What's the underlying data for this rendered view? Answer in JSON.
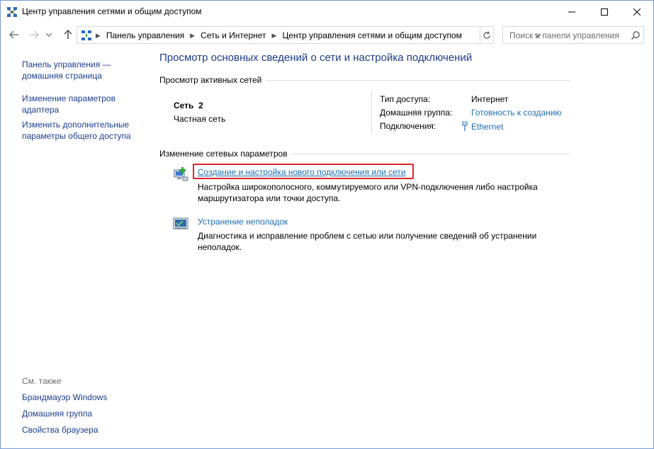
{
  "window": {
    "title": "Центр управления сетями и общим доступом"
  },
  "address": {
    "crumbs": [
      "Панель управления",
      "Сеть и Интернет",
      "Центр управления сетями и общим доступом"
    ],
    "search_placeholder": "Поиск в панели управления"
  },
  "left_pane": {
    "home_link": "Панель управления — домашняя страница",
    "adapter_link": "Изменение параметров адаптера",
    "sharing_link": "Изменить дополнительные параметры общего доступа",
    "see_also_label": "См. также",
    "see_also": [
      "Брандмауэр Windows",
      "Домашняя группа",
      "Свойства браузера"
    ]
  },
  "main": {
    "title": "Просмотр основных сведений о сети и настройка подключений",
    "active_networks_header": "Просмотр активных сетей",
    "network_name": "Сеть  2",
    "network_type": "Частная сеть",
    "access_type_label": "Тип доступа:",
    "access_type_value": "Интернет",
    "homegroup_label": "Домашняя группа:",
    "homegroup_value": "Готовность к созданию",
    "connections_label": "Подключения:",
    "connections_value": "Ethernet",
    "change_settings_header": "Изменение сетевых параметров",
    "task1_link": "Создание и настройка нового подключения или сети",
    "task1_desc": "Настройка широкополосного, коммутируемого или VPN-подключения либо настройка маршрутизатора или точки доступа.",
    "task2_link": "Устранение неполадок",
    "task2_desc": "Диагностика и исправление проблем с сетью или получение сведений об устранении неполадок."
  },
  "colors": {
    "link": "#1a6fb5",
    "title": "#1e3c8c",
    "highlight_box": "#e0242b"
  }
}
